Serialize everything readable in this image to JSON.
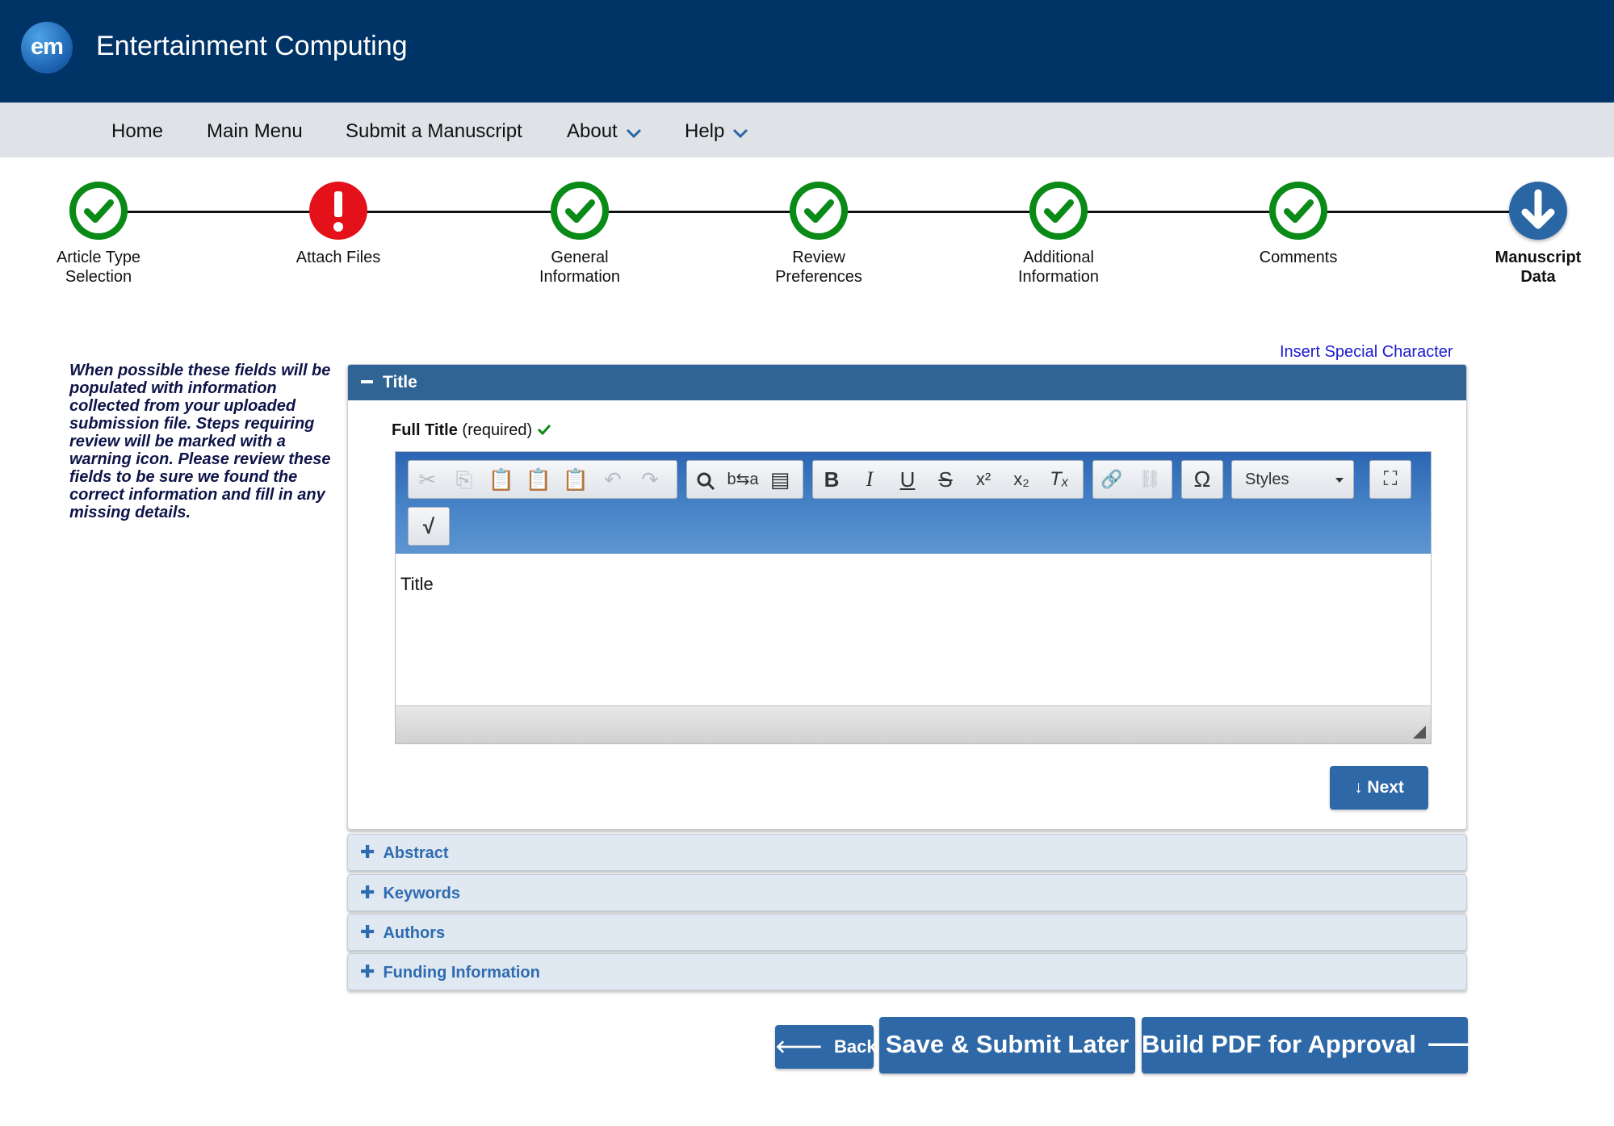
{
  "header": {
    "logo_text": "em",
    "app_title": "Entertainment Computing"
  },
  "nav": {
    "home": "Home",
    "main_menu": "Main Menu",
    "submit": "Submit a Manuscript",
    "about": "About",
    "help": "Help"
  },
  "steps": [
    {
      "label_1": "Article Type",
      "label_2": "Selection",
      "status": "complete"
    },
    {
      "label_1": "Attach Files",
      "label_2": "",
      "status": "error"
    },
    {
      "label_1": "General",
      "label_2": "Information",
      "status": "complete"
    },
    {
      "label_1": "Review",
      "label_2": "Preferences",
      "status": "complete"
    },
    {
      "label_1": "Additional",
      "label_2": "Information",
      "status": "complete"
    },
    {
      "label_1": "Comments",
      "label_2": "",
      "status": "complete"
    },
    {
      "label_1": "Manuscript",
      "label_2": "Data",
      "status": "current"
    }
  ],
  "sidenote": "When possible these fields will be populated with information collected from your uploaded submission file. Steps requiring review will be marked with a warning icon. Please review these fields to be sure we found the correct information and fill in any missing details.",
  "insert_special_character": "Insert Special Character",
  "title_panel": {
    "heading": "Title",
    "field_label": "Full Title",
    "required_text": "(required)",
    "editor_text": "Title",
    "styles_label": "Styles",
    "next_label": "Next"
  },
  "accordions": {
    "abstract": "Abstract",
    "keywords": "Keywords",
    "authors": "Authors",
    "funding": "Funding Information"
  },
  "buttons": {
    "back": "Back",
    "save": "Save & Submit Later",
    "pdf": "Build PDF for Approval"
  },
  "colors": {
    "header": "#013466",
    "accent": "#2f68a6",
    "complete": "#0a8a17",
    "error": "#e4101a"
  }
}
